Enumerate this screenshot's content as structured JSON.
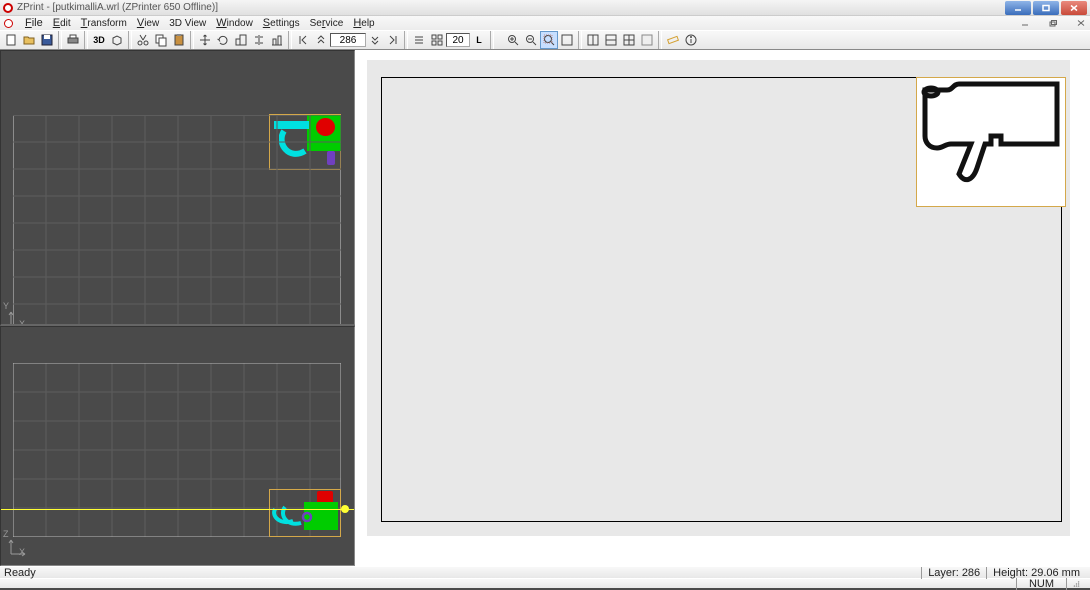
{
  "window": {
    "title": "ZPrint - [putkimalliA.wrl (ZPrinter 650 Offline)]"
  },
  "menu": {
    "file": "File",
    "edit": "Edit",
    "transform": "Transform",
    "view": "View",
    "view3d": "3D View",
    "window": "Window",
    "settings": "Settings",
    "service": "Service",
    "help": "Help"
  },
  "toolbar": {
    "layer_value": "286",
    "layers_input2": "20",
    "mode_label": "L",
    "btn3d": "3D"
  },
  "status": {
    "ready": "Ready",
    "layer": "Layer: 286",
    "height": "Height: 29.06 mm",
    "num": "NUM"
  },
  "axes": {
    "top_v": "Y",
    "top_h": "X",
    "bot_v": "Z",
    "bot_h": "X"
  }
}
